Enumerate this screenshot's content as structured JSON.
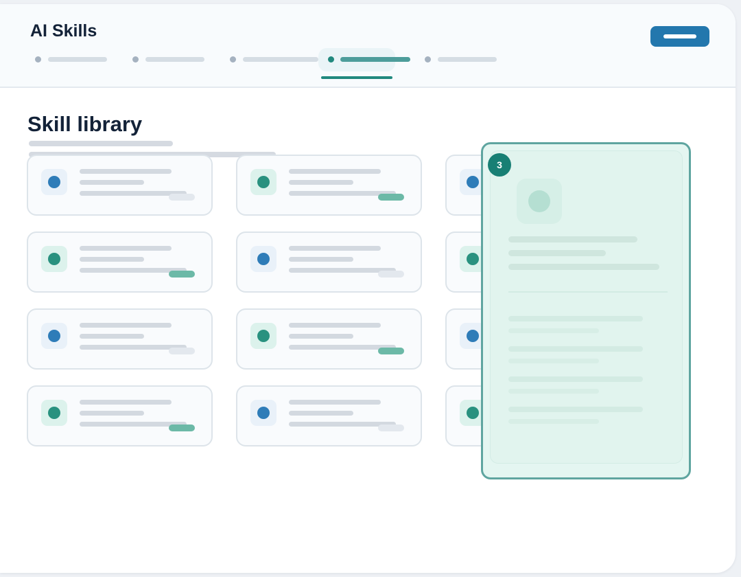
{
  "header": {
    "app_title": "AI Skills",
    "tabs": [
      {
        "active": false
      },
      {
        "active": false
      },
      {
        "active": false
      },
      {
        "active": true
      },
      {
        "active": false
      }
    ]
  },
  "main": {
    "page_title": "Skill library",
    "cards": [
      {
        "accent": "blue"
      },
      {
        "accent": "teal"
      },
      {
        "accent": "blue"
      },
      {
        "accent": "teal"
      },
      {
        "accent": "blue"
      },
      {
        "accent": "teal"
      },
      {
        "accent": "blue"
      },
      {
        "accent": "teal"
      },
      {
        "accent": "blue"
      },
      {
        "accent": "teal"
      },
      {
        "accent": "blue"
      },
      {
        "accent": "teal"
      }
    ]
  },
  "detail_panel": {
    "step_badge": "3"
  },
  "colors": {
    "primary_blue": "#2377ad",
    "accent_teal": "#21897e",
    "panel_background": "#e4f6f1",
    "panel_border": "#5fa5a0"
  }
}
